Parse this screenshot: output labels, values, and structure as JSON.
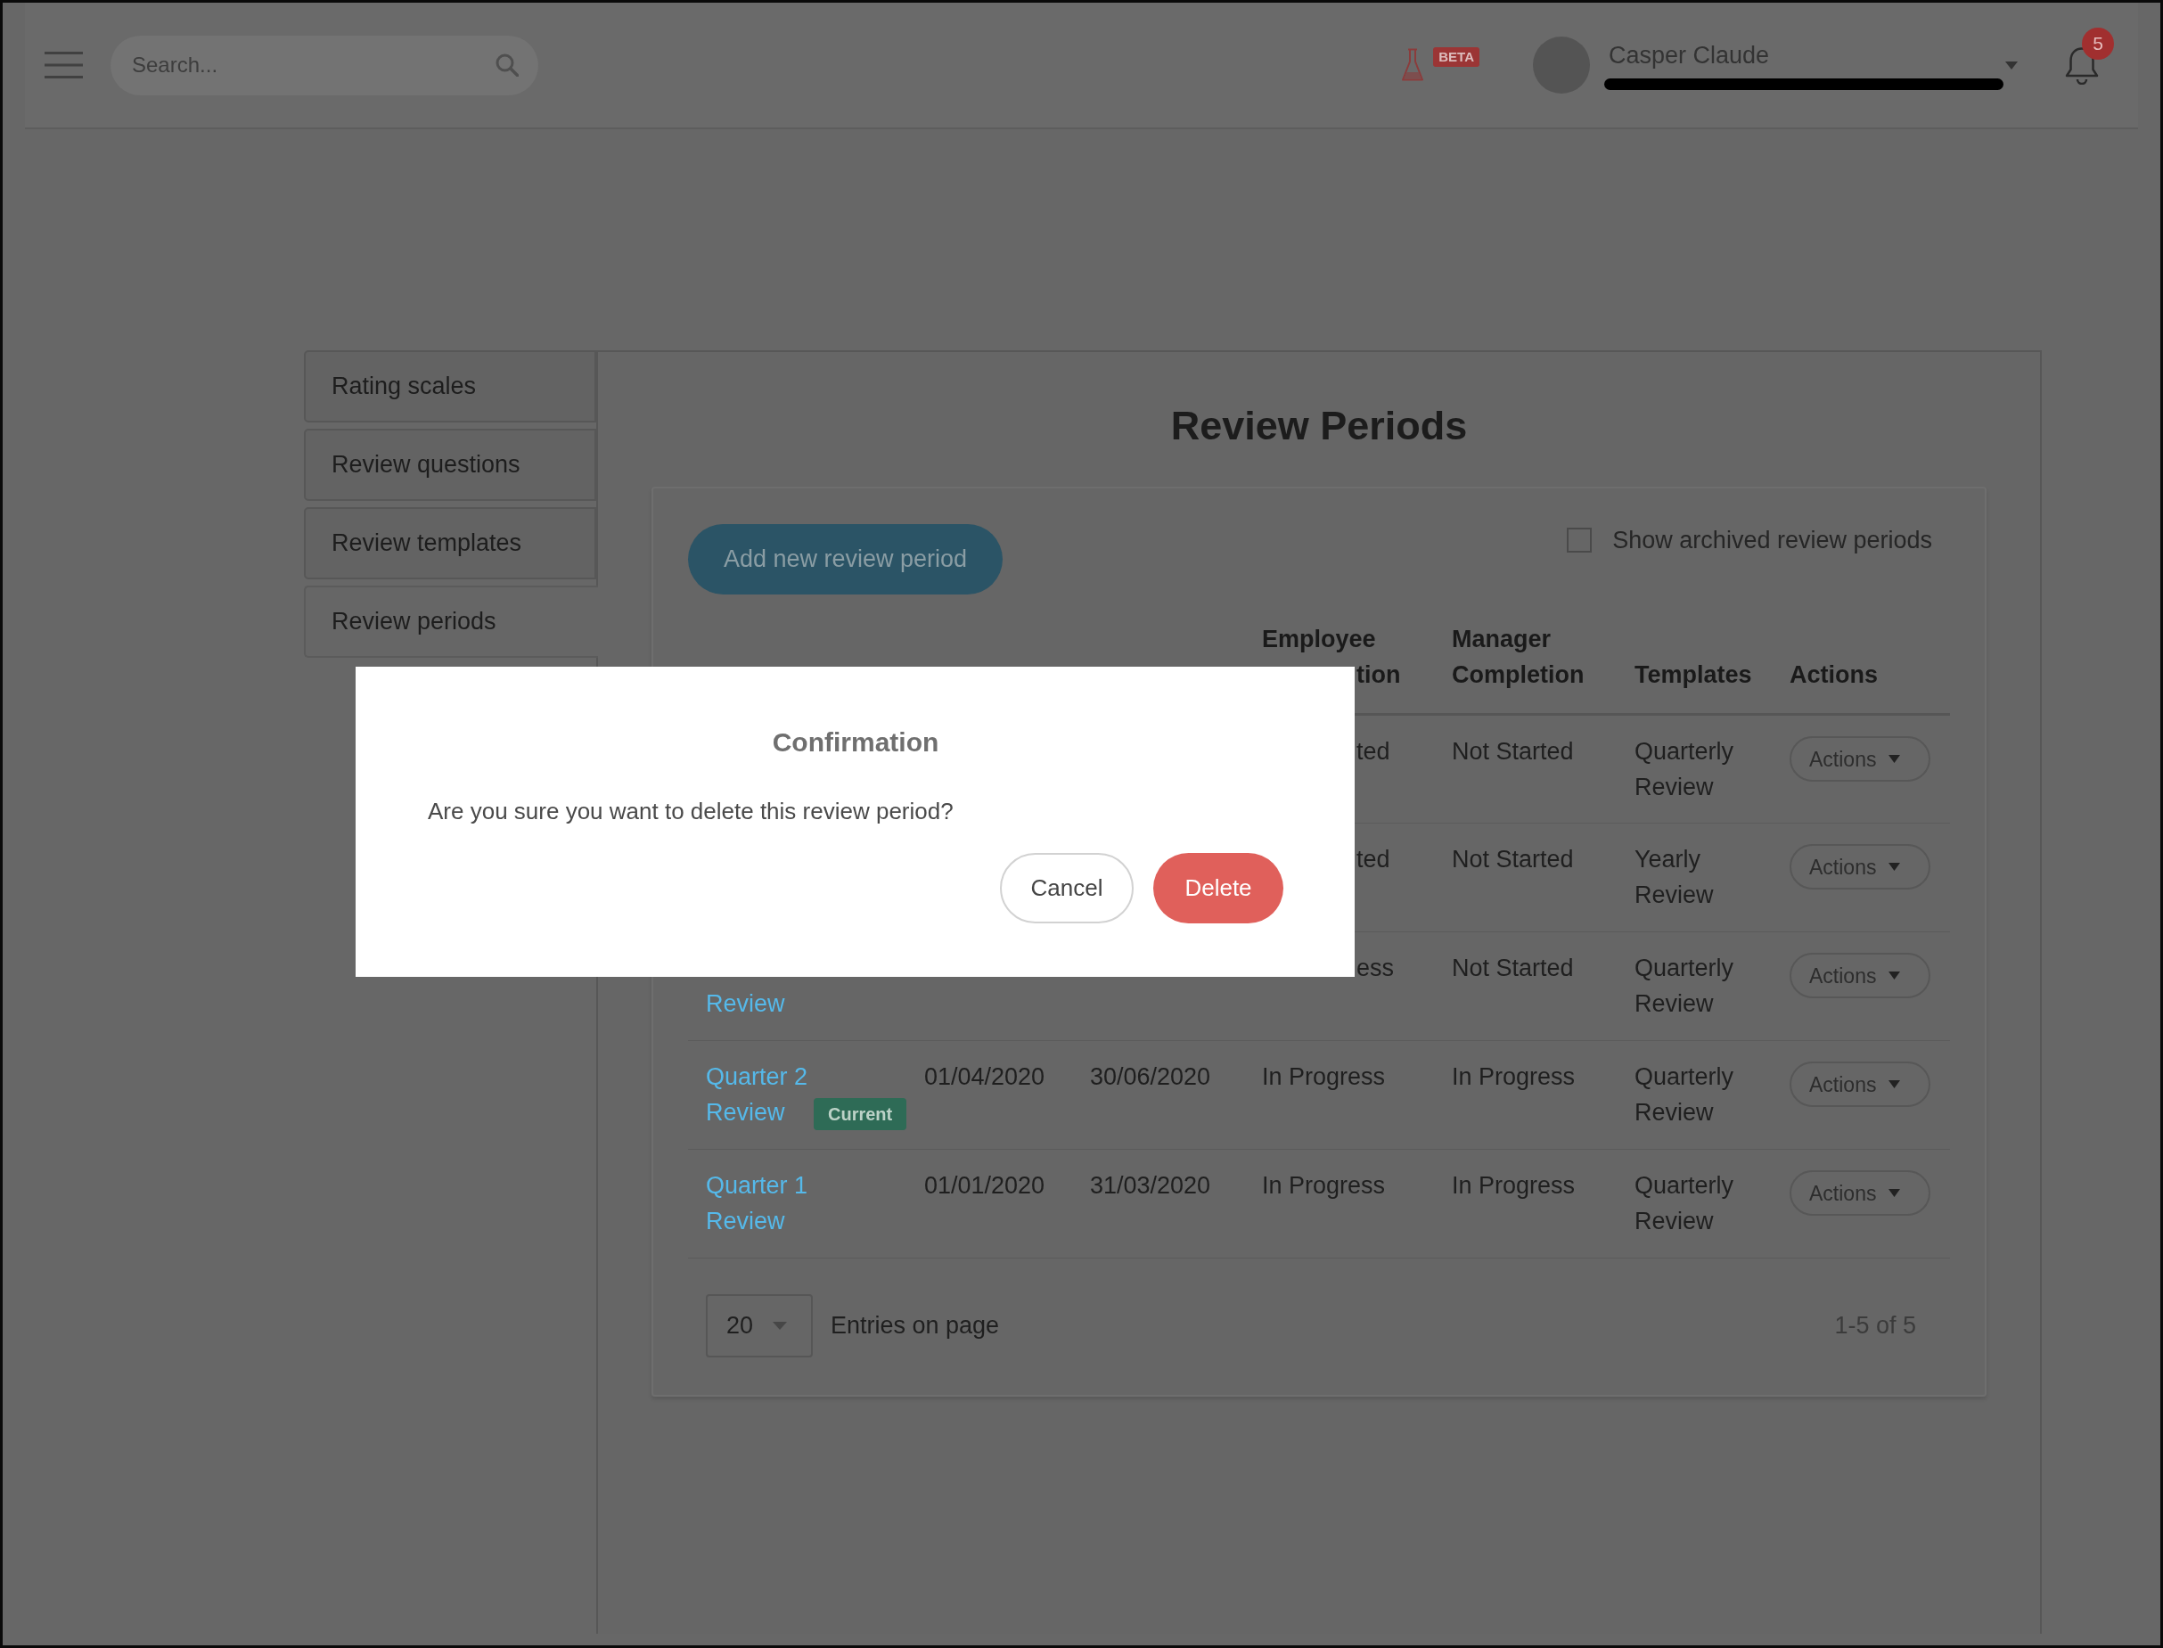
{
  "top_bar": {
    "search": {
      "placeholder": "Search..."
    },
    "beta_badge": "BETA",
    "user": {
      "name": "Casper Claude"
    },
    "notification_count": "5"
  },
  "sidebar": {
    "items": [
      {
        "label": "Rating scales",
        "selected": false
      },
      {
        "label": "Review questions",
        "selected": false
      },
      {
        "label": "Review templates",
        "selected": false
      },
      {
        "label": "Review periods",
        "selected": true
      }
    ]
  },
  "content": {
    "title": "Review Periods",
    "add_button": "Add new review period",
    "show_archived": {
      "label": "Show archived review periods",
      "checked": false
    }
  },
  "table": {
    "columns": [
      {
        "label": "Employee",
        "visible_part": "tion"
      },
      {
        "label": "Manager Completion"
      },
      {
        "label": "Templates"
      },
      {
        "label": "Actions"
      }
    ],
    "rows": [
      {
        "employee_completion_visible_part": "ted",
        "manager_completion": "Not Started",
        "templates": "Quarterly Review",
        "action": "Actions"
      },
      {
        "employee_completion_visible_part": "ted",
        "manager_completion": "Not Started",
        "templates": "Yearly Review",
        "action": "Actions"
      },
      {
        "column_1_visible_part": "Review",
        "employee_completion_visible_part": "ess",
        "manager_completion": "Not Started",
        "templates": "Quarterly Review",
        "action": "Actions"
      },
      {
        "column_1": "Quarter 2 Review",
        "badge": "Current",
        "column_2": "01/04/2020",
        "column_3": "30/06/2020",
        "employee_completion": "In Progress",
        "manager_completion": "In Progress",
        "templates": "Quarterly Review",
        "action": "Actions"
      },
      {
        "column_1": "Quarter 1 Review",
        "column_2": "01/01/2020",
        "column_3": "31/03/2020",
        "employee_completion": "In Progress",
        "manager_completion": "In Progress",
        "templates": "Quarterly Review",
        "action": "Actions"
      }
    ]
  },
  "pagination": {
    "page_size": "20",
    "label": "Entries on page",
    "range": "1-5 of 5"
  },
  "dialog": {
    "title": "Confirmation",
    "message": "Are you sure you want to delete this review period?",
    "buttons": [
      {
        "label": "Cancel",
        "kind": "secondary"
      },
      {
        "label": "Delete",
        "kind": "danger"
      }
    ]
  }
}
